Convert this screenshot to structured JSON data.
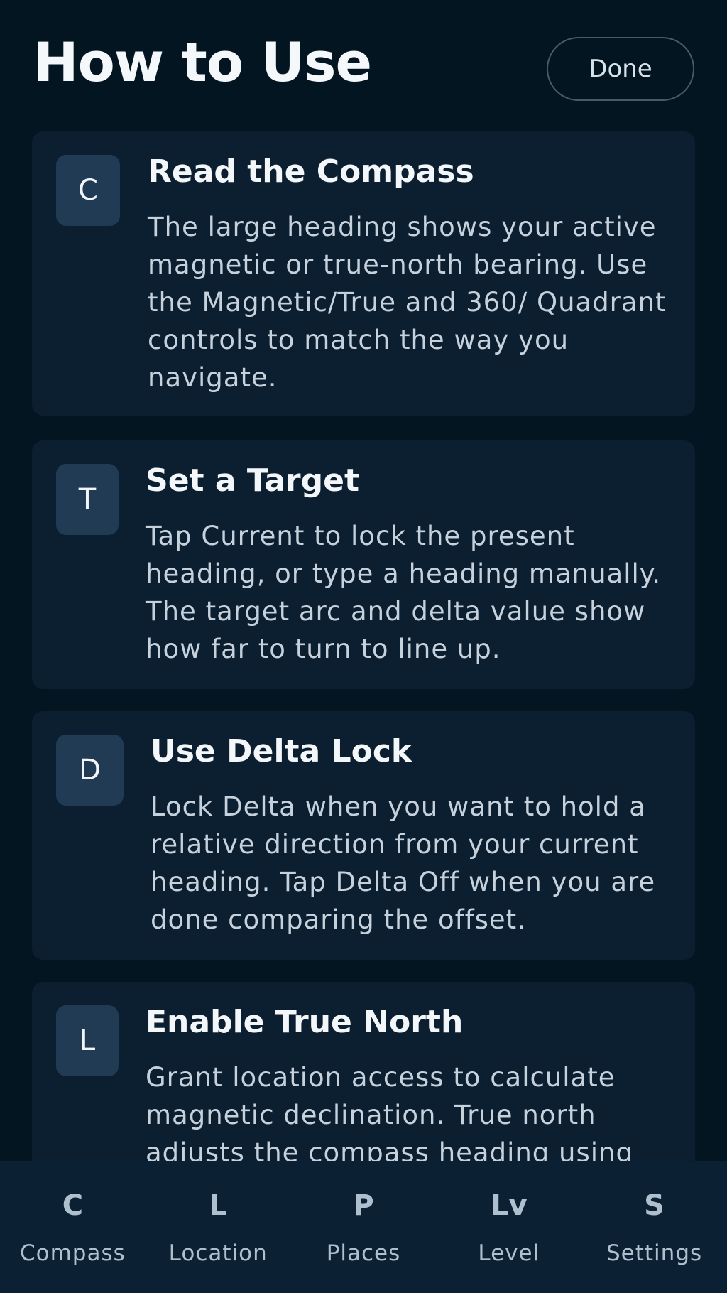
{
  "header": {
    "title": "How to Use",
    "done_label": "Done"
  },
  "cards": [
    {
      "icon": "C",
      "title": "Read the Compass",
      "body": "The large heading shows your active magnetic or true-north bearing. Use the Magnetic/True and 360/ Quadrant controls to match the way you navigate."
    },
    {
      "icon": "T",
      "title": "Set a Target",
      "body": "Tap Current to lock the present heading, or type a heading manually. The target arc and delta value show how far to turn to line up."
    },
    {
      "icon": "D",
      "title": "Use Delta Lock",
      "body": "Lock Delta when you want to hold a relative direction from your current heading. Tap Delta Off when you are done comparing the offset."
    },
    {
      "icon": "L",
      "title": "Enable True North",
      "body": "Grant location access to calculate magnetic declination. True north adjusts the compass heading using"
    }
  ],
  "nav": [
    {
      "icon": "C",
      "label": "Compass"
    },
    {
      "icon": "L",
      "label": "Location"
    },
    {
      "icon": "P",
      "label": "Places"
    },
    {
      "icon": "Lv",
      "label": "Level"
    },
    {
      "icon": "S",
      "label": "Settings"
    }
  ],
  "colors": {
    "background": "#041522",
    "card": "#0b1f30",
    "badge": "#213b55",
    "nav_background": "#0c2033"
  }
}
